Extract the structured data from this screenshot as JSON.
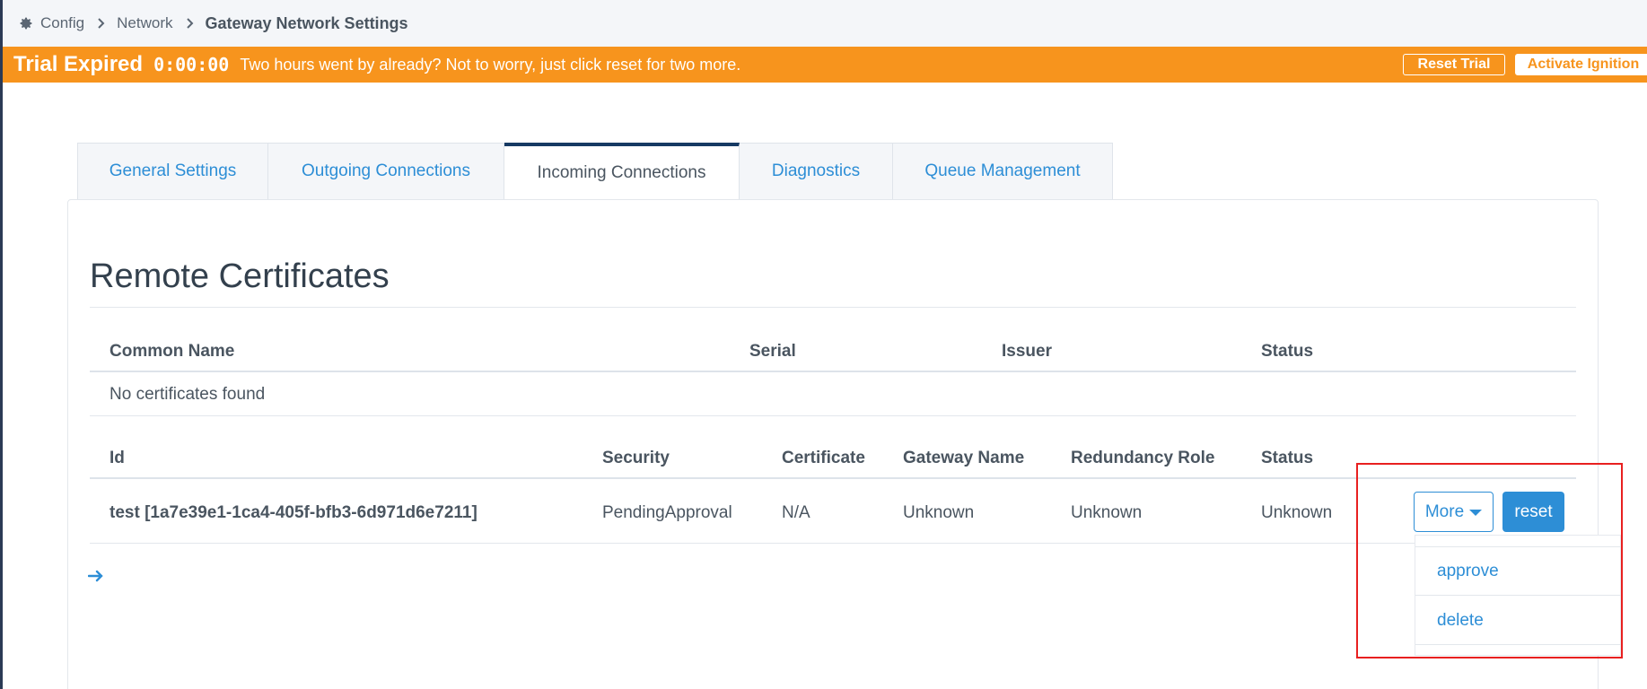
{
  "breadcrumb": {
    "config": "Config",
    "network": "Network",
    "current": "Gateway Network Settings"
  },
  "trial": {
    "title": "Trial Expired",
    "timer": "0:00:00",
    "message": "Two hours went by already? Not to worry, just click reset for two more.",
    "reset_label": "Reset Trial",
    "activate_label": "Activate Ignition",
    "color": "#f7941d"
  },
  "tabs": [
    {
      "label": "General Settings"
    },
    {
      "label": "Outgoing Connections"
    },
    {
      "label": "Incoming Connections",
      "active": true
    },
    {
      "label": "Diagnostics"
    },
    {
      "label": "Queue Management"
    }
  ],
  "certificates": {
    "title": "Remote Certificates",
    "columns": [
      "Common Name",
      "Serial",
      "Issuer",
      "Status"
    ],
    "empty_text": "No certificates found"
  },
  "connections": {
    "columns": [
      "Id",
      "Security",
      "Certificate",
      "Gateway Name",
      "Redundancy Role",
      "Status"
    ],
    "rows": [
      {
        "id": "test [1a7e39e1-1ca4-405f-bfb3-6d971d6e7211]",
        "security": "PendingApproval",
        "certificate": "N/A",
        "gateway_name": "Unknown",
        "redundancy_role": "Unknown",
        "status": "Unknown"
      }
    ],
    "more_label": "More",
    "reset_label": "reset",
    "dropdown": [
      "approve",
      "delete"
    ]
  },
  "colors": {
    "accent": "#2d8ed6",
    "highlight": "#e82020",
    "tab_active_border": "#163a63"
  },
  "icons": {
    "breadcrumb": "gear-icon",
    "separator": "chevron-right-icon",
    "more_caret": "caret-down-icon",
    "footer_link": "arrow-right-icon"
  }
}
